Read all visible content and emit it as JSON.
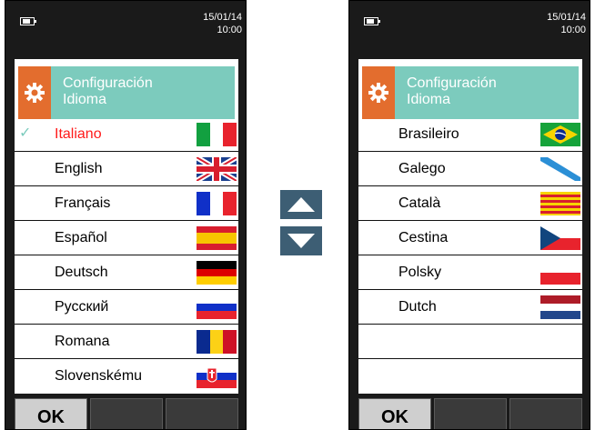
{
  "left_screen": {
    "date": "15/01/14",
    "time": "10:00",
    "header_line1": "Configuración",
    "header_line2": "Idioma",
    "check_mark": "✓",
    "ok_label": "OK",
    "items": [
      {
        "label": "Italiano",
        "flag": "italy-flag",
        "selected": true
      },
      {
        "label": "English",
        "flag": "uk-flag"
      },
      {
        "label": "Français",
        "flag": "france-flag"
      },
      {
        "label": "Español",
        "flag": "spain-flag"
      },
      {
        "label": "Deutsch",
        "flag": "germany-flag"
      },
      {
        "label": "Русский",
        "flag": "russia-flag"
      },
      {
        "label": "Romana",
        "flag": "romania-flag"
      },
      {
        "label": "Slovenskému",
        "flag": "slovakia-flag"
      }
    ]
  },
  "right_screen": {
    "date": "15/01/14",
    "time": "10:00",
    "header_line1": "Configuración",
    "header_line2": "Idioma",
    "ok_label": "OK",
    "items": [
      {
        "label": "Brasileiro",
        "flag": "brazil-flag"
      },
      {
        "label": "Galego",
        "flag": "galicia-flag"
      },
      {
        "label": "Català",
        "flag": "catalonia-flag"
      },
      {
        "label": "Cestina",
        "flag": "czech-flag"
      },
      {
        "label": "Polsky",
        "flag": "poland-flag"
      },
      {
        "label": "Dutch",
        "flag": "netherlands-flag"
      },
      {
        "label": "",
        "flag": ""
      },
      {
        "label": "",
        "flag": ""
      }
    ]
  },
  "navigation": {
    "up_icon": "triangle-up-icon",
    "down_icon": "triangle-down-icon"
  },
  "colors": {
    "accent_teal": "#7ccbbd",
    "accent_orange": "#e36d2e",
    "selected_text": "#ff1a1a",
    "nav_button": "#3d5e74"
  }
}
